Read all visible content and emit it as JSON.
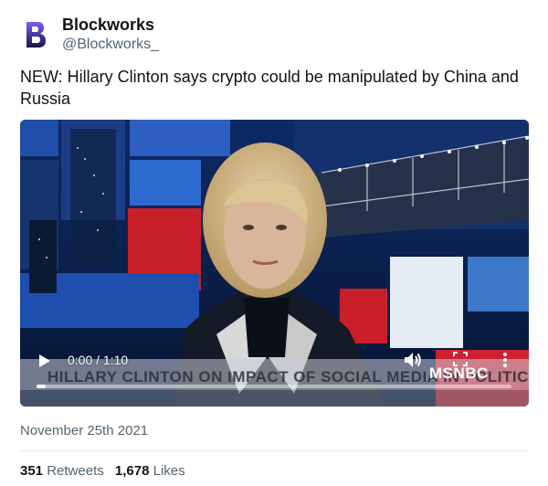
{
  "author": {
    "display_name": "Blockworks",
    "handle": "@Blockworks_",
    "avatar_icon": "blockworks-logo-icon"
  },
  "tweet": {
    "text": "NEW: Hillary Clinton says crypto could be manipulated by China and Russia",
    "date": "November 25th 2021"
  },
  "video": {
    "time_display": "0:00 / 1:10",
    "progress": 0.02,
    "chyron": "HILLARY CLINTON ON IMPACT OF SOCIAL MEDIA IN POLITICS",
    "network": "MSNBC",
    "icons": [
      "play-icon",
      "volume-icon",
      "fullscreen-icon",
      "more-options-icon"
    ]
  },
  "stats": {
    "retweets_count": "351",
    "retweets_label": "Retweets",
    "likes_count": "1,678",
    "likes_label": "Likes"
  },
  "colors": {
    "text": "#0f1419",
    "secondary": "#536471",
    "logo_purple": "#5b3fd9"
  }
}
